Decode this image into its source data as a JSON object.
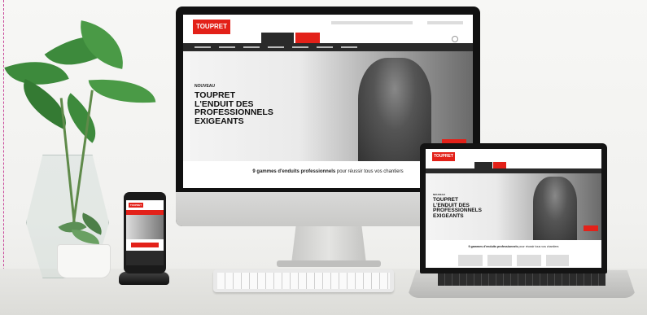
{
  "brand": {
    "logo_text": "TOUPRET",
    "accent": "#e32119"
  },
  "hero": {
    "kicker": "NOUVEAU",
    "title_lines": [
      "TOUPRET",
      "L'ENDUIT DES",
      "PROFESSIONNELS",
      "EXIGEANTS"
    ]
  },
  "tagline": {
    "bold": "9 gammes d'enduits professionnels",
    "rest": "pour réussir tous vos chantiers"
  },
  "colors": {
    "nav": "#2a2a2a",
    "background": "#f3f3f1",
    "plant": "#3d8a3c"
  }
}
